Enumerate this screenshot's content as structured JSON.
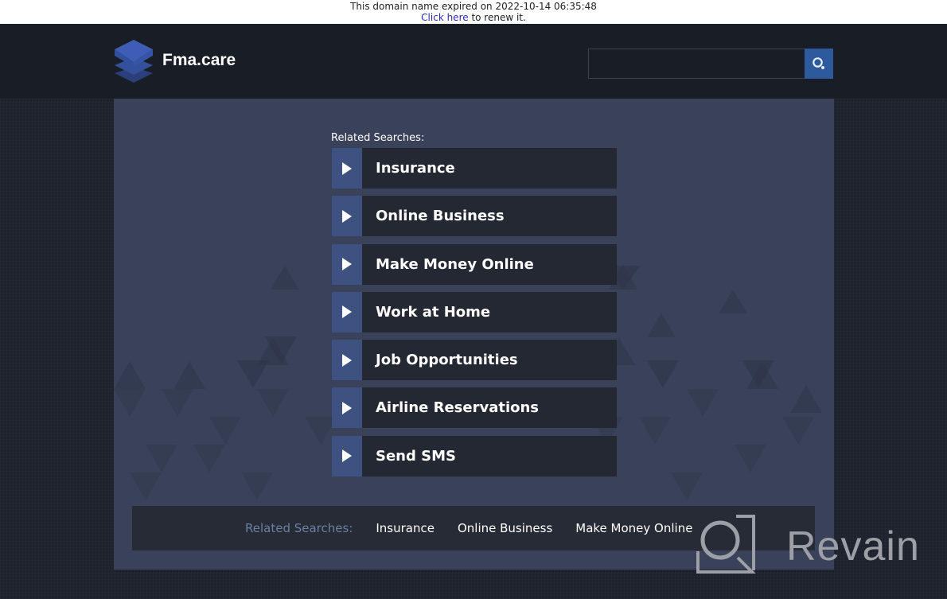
{
  "notice": {
    "expired_text": "This domain name expired on 2022-10-14 06:35:48",
    "renew_link": "Click here",
    "renew_suffix": " to renew it."
  },
  "header": {
    "site_name": "Fma.care",
    "logo_icon": "layers-stack-icon",
    "search": {
      "value": "",
      "placeholder": ""
    },
    "search_button_icon": "search-icon"
  },
  "main": {
    "related_label": "Related Searches:",
    "links": [
      {
        "label": "Insurance",
        "icon": "play-arrow-icon"
      },
      {
        "label": "Online Business",
        "icon": "play-arrow-icon"
      },
      {
        "label": "Make Money Online",
        "icon": "play-arrow-icon"
      },
      {
        "label": "Work at Home",
        "icon": "play-arrow-icon"
      },
      {
        "label": "Job Opportunities",
        "icon": "play-arrow-icon"
      },
      {
        "label": "Airline Reservations",
        "icon": "play-arrow-icon"
      },
      {
        "label": "Send SMS",
        "icon": "play-arrow-icon"
      }
    ]
  },
  "footer": {
    "label": "Related Searches:",
    "links": [
      "Insurance",
      "Online Business",
      "Make Money Online"
    ]
  },
  "watermark": {
    "text": "Revain",
    "icon": "revain-logo-icon"
  },
  "colors": {
    "accent": "#2c5a9c",
    "arrow_block": "#3e5281",
    "link_bg": "#232833",
    "panel_bg": "#394259",
    "header_bg": "#191d26",
    "footer_label": "#6b80a2"
  }
}
